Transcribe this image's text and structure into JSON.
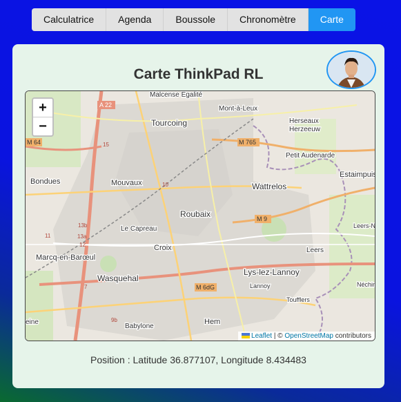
{
  "tabs": [
    "Calculatrice",
    "Agenda",
    "Boussole",
    "Chronomètre",
    "Carte"
  ],
  "active_tab": "Carte",
  "title": "Carte ThinkPad RL",
  "map": {
    "zoom_in": "+",
    "zoom_out": "−",
    "places": [
      "Malcense Egalité",
      "Mont-à-Leux",
      "Herseaux",
      "Herzeeuw",
      "Tourcoing",
      "Petit Audenarde",
      "Estaimpuis",
      "Bondues",
      "Mouvaux",
      "Wattrelos",
      "Roubaix",
      "Leers-Nord",
      "Le Capreau",
      "Croix",
      "Leers",
      "Marcq-en-Barœul",
      "Wasquehal",
      "Lys-lez-Lannoy",
      "Lannoy",
      "Néchin",
      "Toufflers",
      "Hem",
      "Babylone",
      "eine"
    ],
    "roads": [
      "A 22",
      "M 765",
      "M 64",
      "M 9",
      "M 6dG",
      "15",
      "10",
      "13b",
      "13a",
      "11",
      "12",
      "7",
      "9b"
    ],
    "attribution": {
      "leaflet": "Leaflet",
      "separator": " | © ",
      "osm": "OpenStreetMap",
      "suffix": " contributors"
    }
  },
  "position_text": "Position : Latitude 36.877107, Longitude 8.434483"
}
